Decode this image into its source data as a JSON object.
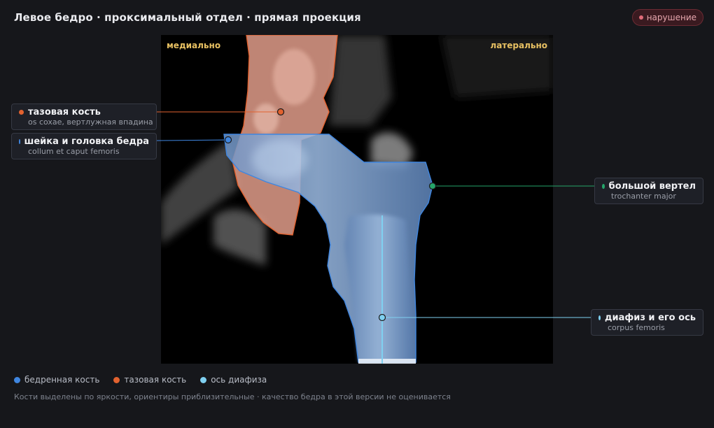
{
  "header": {
    "title": "Левое бедро · проксимальный отдел · прямая проекция",
    "status_badge": "нарушение"
  },
  "image": {
    "left_label": "медиально",
    "right_label": "латерально"
  },
  "callouts": [
    {
      "name": "тазовая кость",
      "subtitle": "os coxae, вертлужная впадина",
      "color": "#e2622f"
    },
    {
      "name": "шейка и головка бедра",
      "subtitle": "collum et caput femoris",
      "color": "#3f86e0"
    },
    {
      "name": "большой вертел",
      "subtitle": "trochanter major",
      "color": "#25a56a"
    },
    {
      "name": "диафиз и его ось",
      "subtitle": "corpus femoris",
      "color": "#7fd0f0"
    }
  ],
  "legend": [
    {
      "label": "бедренная кость",
      "color": "#3f86e0"
    },
    {
      "label": "тазовая кость",
      "color": "#e2622f"
    },
    {
      "label": "ось диафиза",
      "color": "#7fd0f0"
    }
  ],
  "footnote": "Кости выделены по яркости, ориентиры приблизительные · качество бедра в этой версии не оценивается",
  "colors": {
    "femur": "#3f86e0",
    "pelvis": "#e2622f",
    "axis": "#7fd0f0",
    "trochanter": "#25a56a",
    "badge": "#e06b78"
  }
}
